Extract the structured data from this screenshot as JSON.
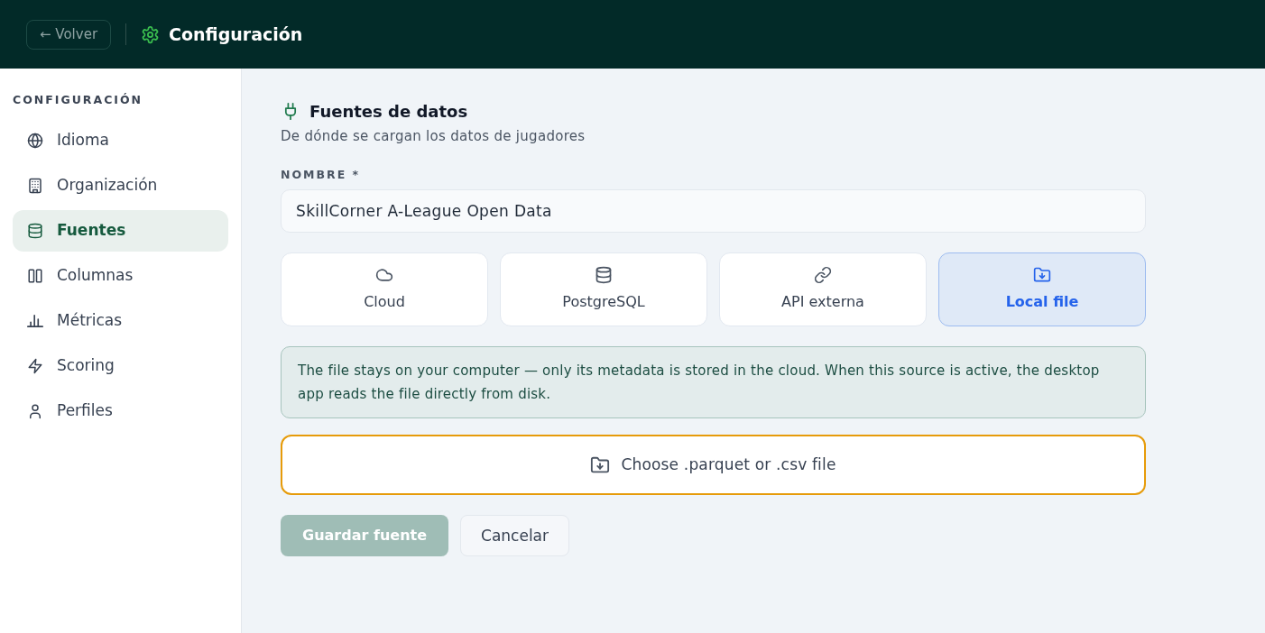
{
  "header": {
    "back_button": "← Volver",
    "title": "Configuración"
  },
  "sidebar": {
    "heading": "CONFIGURACIÓN",
    "items": [
      {
        "label": "Idioma",
        "selected": false
      },
      {
        "label": "Organización",
        "selected": false
      },
      {
        "label": "Fuentes",
        "selected": true
      },
      {
        "label": "Columnas",
        "selected": false
      },
      {
        "label": "Métricas",
        "selected": false
      },
      {
        "label": "Scoring",
        "selected": false
      },
      {
        "label": "Perfiles",
        "selected": false
      }
    ]
  },
  "section": {
    "title": "Fuentes de datos",
    "subtitle": "De dónde se cargan los datos de jugadores"
  },
  "name_field": {
    "label": "NOMBRE *",
    "value": "SkillCorner A-League Open Data"
  },
  "source_types": [
    {
      "label": "Cloud",
      "selected": false
    },
    {
      "label": "PostgreSQL",
      "selected": false
    },
    {
      "label": "API externa",
      "selected": false
    },
    {
      "label": "Local file",
      "selected": true
    }
  ],
  "notice": "The file stays on your computer — only its metadata is stored in the cloud. When this source is active, the desktop app reads the file directly from disk.",
  "file_picker": {
    "label": "Choose .parquet or .csv file",
    "focused": true
  },
  "save_button": {
    "label": "Guardar fuente",
    "disabled": true
  },
  "cancel_button": {
    "label": "Cancelar"
  }
}
